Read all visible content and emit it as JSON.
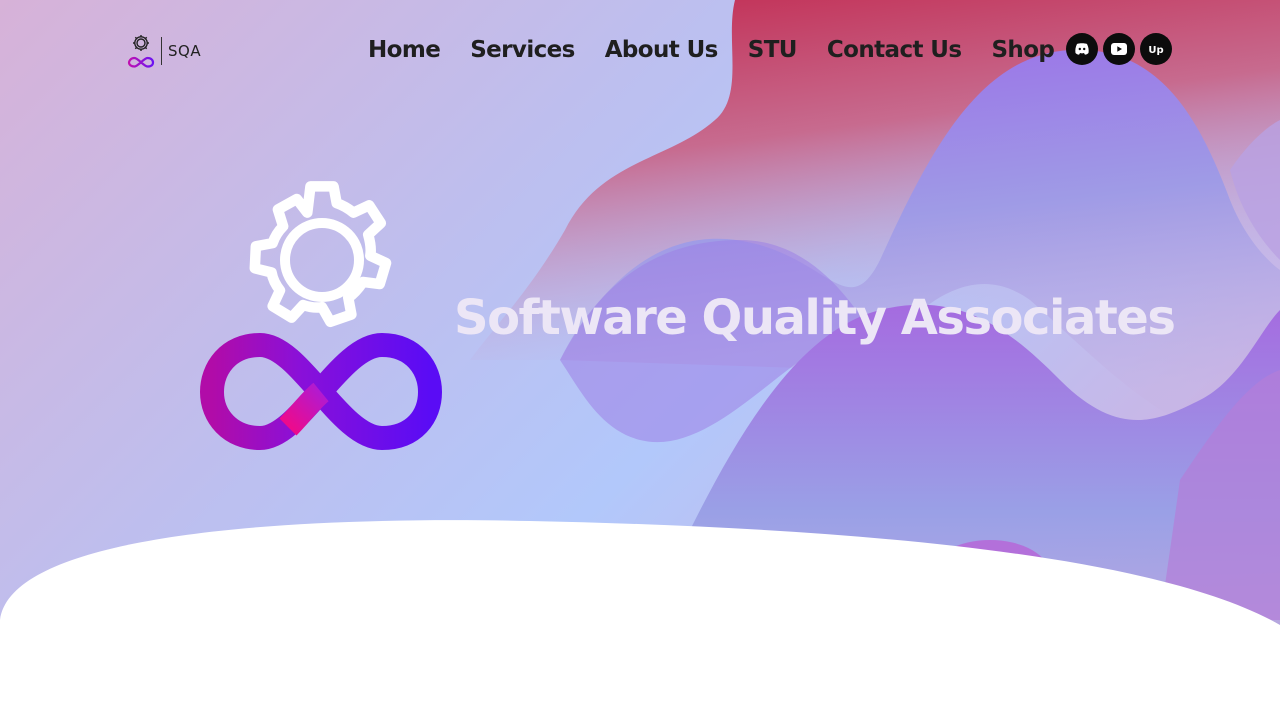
{
  "brand": {
    "logo_text": "SQA"
  },
  "nav": {
    "items": [
      {
        "label": "Home"
      },
      {
        "label": "Services"
      },
      {
        "label": "About Us"
      },
      {
        "label": "STU"
      },
      {
        "label": "Contact Us"
      },
      {
        "label": "Shop"
      }
    ]
  },
  "social": {
    "icons": [
      "discord-icon",
      "youtube-icon",
      "upwork-icon"
    ],
    "upwork_glyph": "Up"
  },
  "hero": {
    "title": "Software Quality Associates"
  },
  "colors": {
    "infinity_start": "#b10ca8",
    "infinity_pink": "#ef0a8a",
    "infinity_end": "#5a0cf5",
    "title": "#ece6f6",
    "nav_text": "#1f1f1f"
  }
}
